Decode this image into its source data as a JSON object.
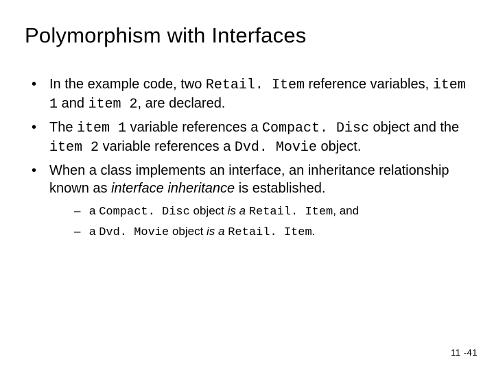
{
  "title": "Polymorphism with Interfaces",
  "bullets": {
    "b1": {
      "pre": "In the example code, two ",
      "code1": "Retail. Item",
      "mid1": " reference variables, ",
      "code2": "item 1",
      "mid2": " and ",
      "code3": "item 2",
      "post": ", are declared."
    },
    "b2": {
      "pre": "The ",
      "code1": "item 1",
      "mid1": " variable references a ",
      "code2": "Compact. Disc",
      "mid2": " object and the ",
      "code3": "item 2",
      "mid3": " variable references a ",
      "code4": "Dvd. Movie",
      "post": " object."
    },
    "b3": {
      "pre": "When a class implements an interface, an inheritance relationship known as ",
      "em": "interface inheritance",
      "post": " is established."
    }
  },
  "sub": {
    "s1": {
      "pre": "a ",
      "code1": "Compact. Disc",
      "mid1": " object ",
      "em": "is a",
      "mid2": " ",
      "code2": "Retail. Item",
      "post": ", and"
    },
    "s2": {
      "pre": "a ",
      "code1": "Dvd. Movie",
      "mid1": " object ",
      "em": "is a",
      "mid2": " ",
      "code2": "Retail. Item",
      "post": "."
    }
  },
  "pagenum": "11 -41"
}
